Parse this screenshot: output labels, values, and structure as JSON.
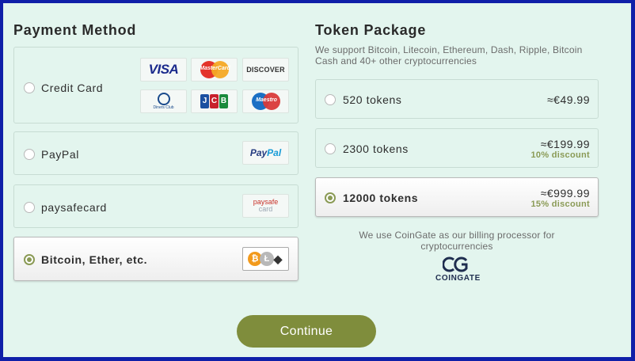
{
  "payment": {
    "title": "Payment Method",
    "methods": [
      {
        "label": "Credit Card",
        "selected": false,
        "logos": [
          "visa-logo",
          "mastercard-logo",
          "discover-logo",
          "diners-club-logo",
          "jcb-logo",
          "maestro-logo"
        ]
      },
      {
        "label": "PayPal",
        "selected": false,
        "logos": [
          "paypal-logo"
        ]
      },
      {
        "label": "paysafecard",
        "selected": false,
        "logos": [
          "paysafecard-logo"
        ]
      },
      {
        "label": "Bitcoin, Ether, etc.",
        "selected": true,
        "logos": [
          "bitcoin-icon",
          "litecoin-icon",
          "ethereum-icon"
        ]
      }
    ]
  },
  "logos": {
    "visa": "VISA",
    "mastercard": "MasterCard",
    "discover": "DISCOVER",
    "diners": "Diners Club",
    "jcb": [
      "J",
      "C",
      "B"
    ],
    "maestro": "Maestro",
    "paypal_a": "Pay",
    "paypal_b": "Pal",
    "paysafe_1": "paysafe",
    "paysafe_2": "card",
    "btc": "₿",
    "ltc": "Ł",
    "eth": "◆"
  },
  "tokens": {
    "title": "Token Package",
    "subtitle": "We support Bitcoin, Litecoin, Ethereum, Dash, Ripple, Bitcoin Cash and 40+ other cryptocurrencies",
    "packages": [
      {
        "label": "520 tokens",
        "price": "≈€49.99",
        "discount": "",
        "selected": false
      },
      {
        "label": "2300 tokens",
        "price": "≈€199.99",
        "discount": "10% discount",
        "selected": false
      },
      {
        "label": "12000 tokens",
        "price": "≈€999.99",
        "discount": "15% discount",
        "selected": true
      }
    ],
    "processor_note": "We use CoinGate as our billing processor for cryptocurrencies",
    "processor_logo_text": "COINGATE"
  },
  "actions": {
    "continue_label": "Continue"
  },
  "colors": {
    "accent": "#7f8d3c",
    "background": "#e3f5ee",
    "border_frame": "#0f1fa8"
  }
}
